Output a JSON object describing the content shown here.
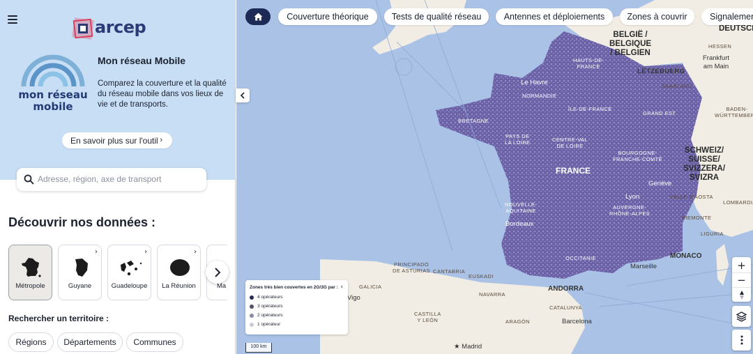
{
  "sidebar": {
    "logo_text": "arcep",
    "brand_line1": "mon réseau",
    "brand_line2": "mobile",
    "title": "Mon réseau Mobile",
    "description": "Comparez la couverture et la qualité du réseau mobile dans vos lieux de vie et de transports.",
    "learn_more": "En savoir plus sur l'outil",
    "search_placeholder": "Adresse, région, axe de transport",
    "discover_title": "Découvrir nos données :",
    "cards": [
      {
        "label": "Métropole",
        "selected": true
      },
      {
        "label": "Guyane",
        "selected": false
      },
      {
        "label": "Guadeloupe",
        "selected": false
      },
      {
        "label": "La Réunion",
        "selected": false
      },
      {
        "label": "Ma",
        "selected": false
      }
    ],
    "search_territory": "Rechercher un territoire :",
    "chips": [
      "Régions",
      "Départements",
      "Communes"
    ]
  },
  "nav": {
    "tabs": [
      "Couverture théorique",
      "Tests de qualité réseau",
      "Antennes et déploiements",
      "Zones à couvrir",
      "Signalemen"
    ]
  },
  "map": {
    "labels": {
      "belgique": [
        "BELGIË /",
        "BELGIQUE",
        "/ BELGIEN"
      ],
      "deutsch": "DEUTSCH",
      "hessen": "HESSEN",
      "frankfurt": [
        "Frankfurt",
        "am Main"
      ],
      "letzebuerg": "LËTZEBUERG",
      "saarland": "SAARLAND",
      "baden": [
        "BADEN-",
        "WÜRTTEMBERG"
      ],
      "schweiz": [
        "SCHWEIZ/",
        "SUISSE/",
        "SVIZZERA/",
        "SVIZRA"
      ],
      "hauts": [
        "HAUTS-DE-",
        "FRANCE"
      ],
      "le_havre": "Le Havre",
      "normandie": "NORMANDIE",
      "idf": "ÎLE-DE-FRANCE",
      "grand_est": "GRAND EST",
      "bretagne": "BRETAGNE",
      "pays_loire": [
        "PAYS DE",
        "LA LOIRE"
      ],
      "centre": [
        "CENTRE-VAL",
        "DE LOIRE"
      ],
      "bourgogne": [
        "BOURGOGNE-",
        "FRANCHE-COMTÉ"
      ],
      "france": "FRANCE",
      "geneve": "Genève",
      "aoste": "VALLE D'AOSTA",
      "lombardia": "LOMBARDIA",
      "lyon": "Lyon",
      "nouvelle": [
        "NOUVELLE-",
        "AQUITAINE"
      ],
      "auvergne": [
        "AUVERGNE-",
        "RHÔNE-ALPES"
      ],
      "piemonte": "PIEMONTE",
      "bordeaux": "Bordeaux",
      "liguria": "LIGURIA",
      "monaco": "MONACO",
      "occitanie": "OCCITANIE",
      "marseille": "Marseille",
      "principado": [
        "PRINCIPADO",
        "DE ASTURIAS"
      ],
      "cantabria": "CANTABRIA",
      "euskadi": "EUSKADI",
      "galicia": "GALICIA",
      "vigo": "Vigo",
      "navarra": "NAVARRA",
      "andorra": "ANDORRA",
      "catalunya": "CATALUNYA",
      "castilla": [
        "CASTILLA",
        "Y LEÓN"
      ],
      "aragon": "ARAGÓN",
      "barcelona": "Barcelona",
      "madrid": "Madrid"
    },
    "legend": {
      "title": "Zones très bien couvertes en 2G/3G par :",
      "items": [
        {
          "label": "4 opérateurs",
          "color": "#262b54"
        },
        {
          "label": "3 opérateurs",
          "color": "#4d5068"
        },
        {
          "label": "2 opérateurs",
          "color": "#8a8ca0"
        },
        {
          "label": "1 opérateur",
          "color": "#c9cbd6"
        }
      ]
    },
    "scale": "100 km",
    "coverage_color": "#6b62a8",
    "sea_color": "#a9c2e6",
    "land_color": "#f1ede4"
  }
}
